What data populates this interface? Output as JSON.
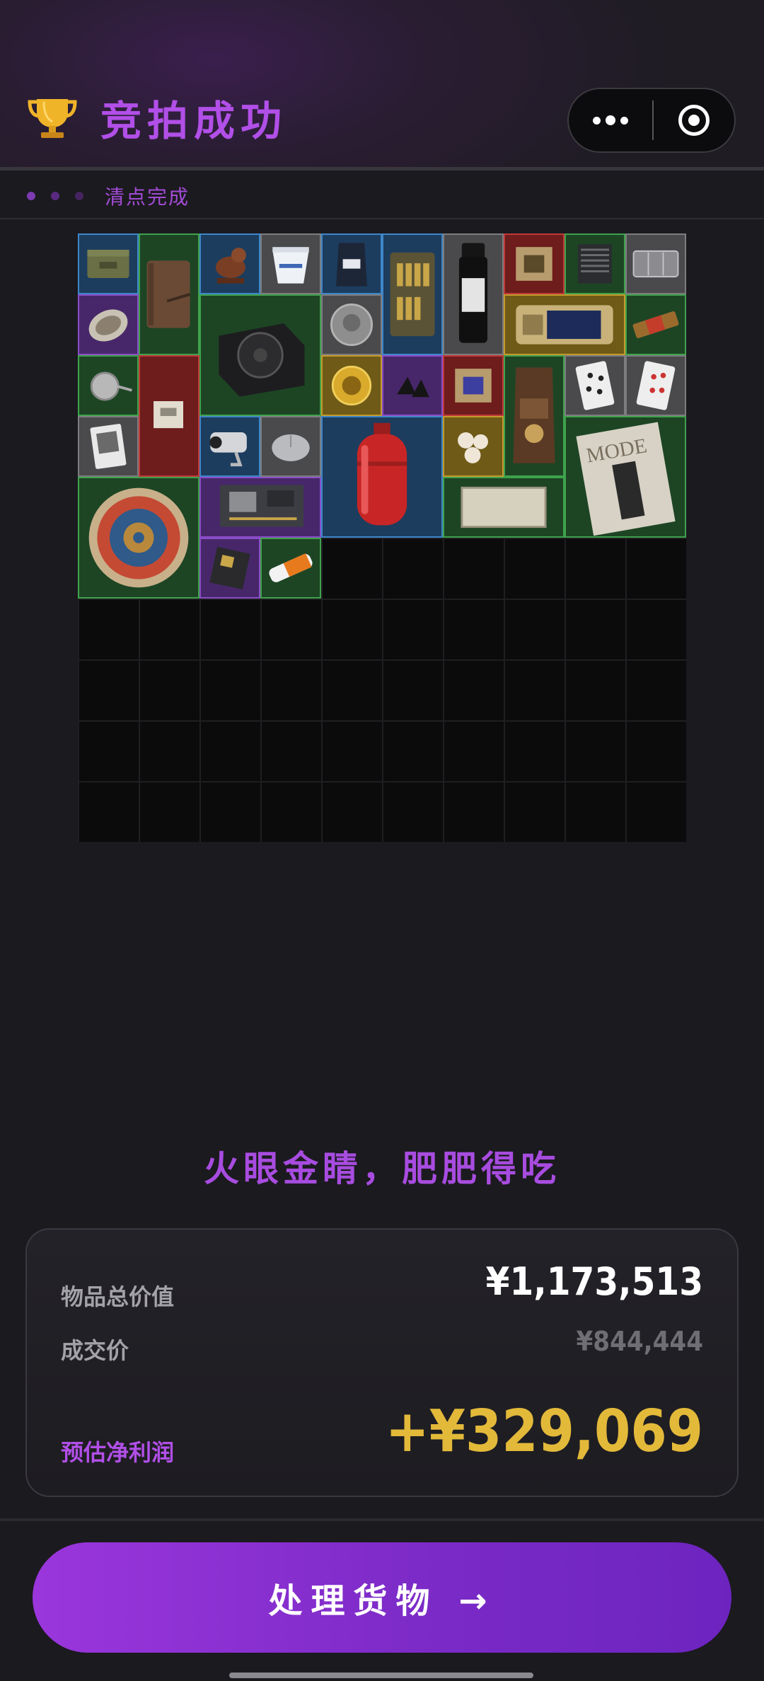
{
  "header": {
    "title": "竞拍成功",
    "trophy_icon": "trophy-icon",
    "capsule": {
      "more_icon": "more-dots-icon",
      "close_icon": "target-close-icon"
    }
  },
  "status": {
    "text": "清点完成",
    "dot_colors": [
      "#7c3bb0",
      "#5a2a80",
      "#45245f"
    ]
  },
  "inventory": {
    "grid_columns": 10,
    "grid_rows": 10,
    "items": [
      {
        "name": "military-ammo-box",
        "rarity": "blue"
      },
      {
        "name": "leather-journal",
        "rarity": "green"
      },
      {
        "name": "bronze-bird-figurine",
        "rarity": "blue"
      },
      {
        "name": "yogurt-cup",
        "rarity": "gray"
      },
      {
        "name": "coffee-bag-small",
        "rarity": "blue"
      },
      {
        "name": "ammo-case",
        "rarity": "blue"
      },
      {
        "name": "medical-sample-vial",
        "rarity": "gray"
      },
      {
        "name": "circuit-board-chip",
        "rarity": "red"
      },
      {
        "name": "cpu-cooler",
        "rarity": "green"
      },
      {
        "name": "plastic-organizer",
        "rarity": "gray"
      },
      {
        "name": "pocket-watch",
        "rarity": "purple"
      },
      {
        "name": "power-supply-unit",
        "rarity": "green"
      },
      {
        "name": "silver-coin",
        "rarity": "blue"
      },
      {
        "name": "electronic-module",
        "rarity": "gold"
      },
      {
        "name": "energy-bar",
        "rarity": "green"
      },
      {
        "name": "compass-thermometer",
        "rarity": "green"
      },
      {
        "name": "red-fabric-note",
        "rarity": "red"
      },
      {
        "name": "gold-medallion",
        "rarity": "gold"
      },
      {
        "name": "binder-clips",
        "rarity": "purple"
      },
      {
        "name": "circuit-chip",
        "rarity": "red"
      },
      {
        "name": "arabica-coffee-bag",
        "rarity": "green"
      },
      {
        "name": "playing-card-spades",
        "rarity": "gray"
      },
      {
        "name": "playing-card-hearts",
        "rarity": "gray"
      },
      {
        "name": "photo-card",
        "rarity": "gray"
      },
      {
        "name": "security-camera",
        "rarity": "blue"
      },
      {
        "name": "computer-mouse",
        "rarity": "gray"
      },
      {
        "name": "gas-cylinder",
        "rarity": "blue"
      },
      {
        "name": "pearls",
        "rarity": "gold"
      },
      {
        "name": "mode-magazine",
        "rarity": "green"
      },
      {
        "name": "decorative-plate",
        "rarity": "green"
      },
      {
        "name": "motherboard",
        "rarity": "purple"
      },
      {
        "name": "old-parchment",
        "rarity": "green"
      },
      {
        "name": "small-chip",
        "rarity": "purple"
      },
      {
        "name": "battery-3000mah",
        "rarity": "green"
      }
    ]
  },
  "slogan": "火眼金睛，肥肥得吃",
  "summary": {
    "total_label": "物品总价值",
    "total_value": "¥1,173,513",
    "deal_label": "成交价",
    "deal_value": "¥844,444",
    "profit_label": "预估净利润",
    "profit_value": "+¥329,069"
  },
  "cta": {
    "label": "处理货物 →"
  },
  "colors": {
    "accent_purple": "#b14fe8",
    "profit_gold": "#e3b93a",
    "background": "#1b1a1f"
  }
}
